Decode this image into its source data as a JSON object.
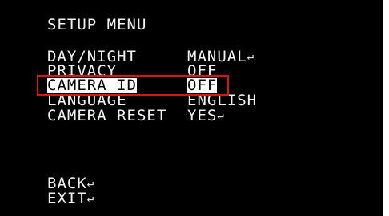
{
  "menu": {
    "title": "SETUP MENU",
    "items": [
      {
        "label": "DAY/NIGHT",
        "value": "MANUAL",
        "enter_icon": "↵"
      },
      {
        "label": "PRIVACY",
        "value": "OFF",
        "enter_icon": ""
      },
      {
        "label": "CAMERA ID",
        "value": "OFF",
        "enter_icon": ""
      },
      {
        "label": "LANGUAGE",
        "value": "ENGLISH",
        "enter_icon": ""
      },
      {
        "label": "CAMERA RESET",
        "value": "YES",
        "enter_icon": "↵"
      }
    ],
    "back_label": "BACK",
    "back_icon": "↵",
    "exit_label": "EXIT",
    "exit_icon": "↵"
  },
  "colors": {
    "background": "#000000",
    "text": "#f2f2f2",
    "highlight_frame": "#d91616",
    "selected_background": "#ffffff",
    "selected_text": "#000000"
  },
  "selected_item": "CAMERA ID"
}
